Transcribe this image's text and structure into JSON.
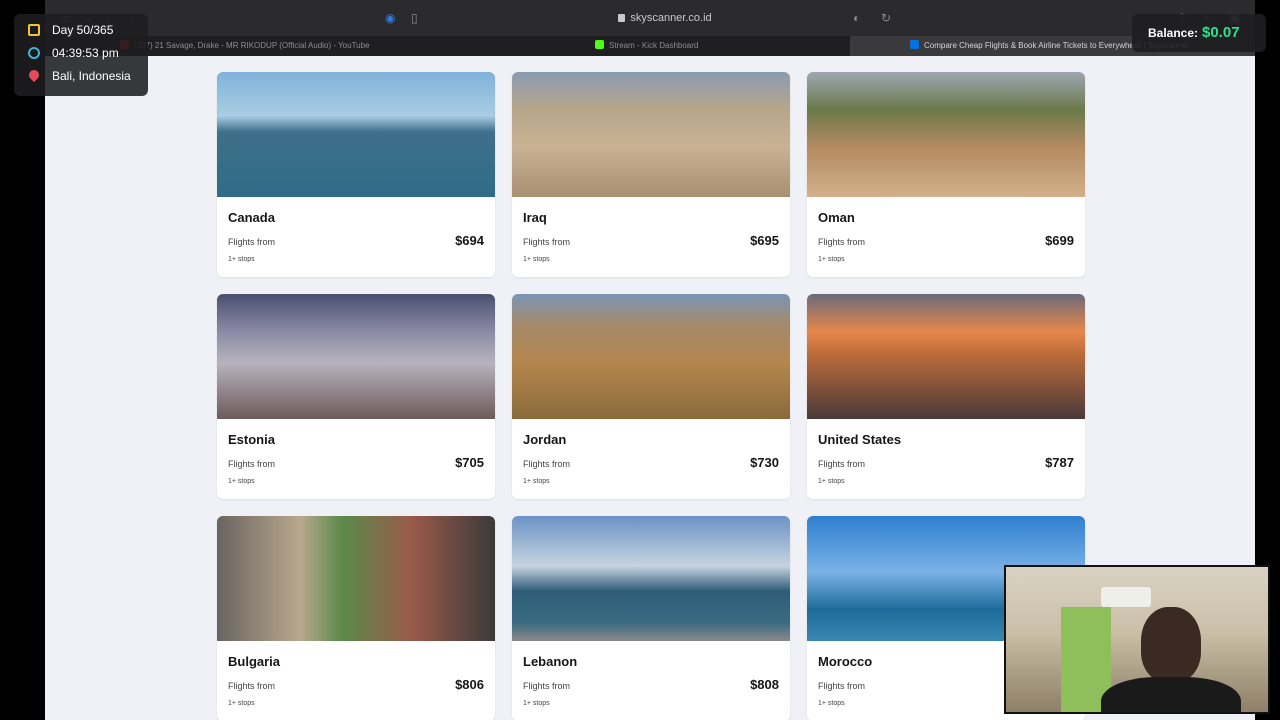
{
  "browser": {
    "url": "skyscanner.co.id",
    "tabs": [
      {
        "label": "(387) 21 Savage, Drake - MR RIKODUP (Official Audio) - YouTube",
        "fav_color": "#e62117"
      },
      {
        "label": "Stream - Kick Dashboard",
        "fav_color": "#53fc18"
      },
      {
        "label": "Compare Cheap Flights & Book Airline Tickets to Everywhere | Skyscanner",
        "fav_color": "#0770e3"
      }
    ]
  },
  "destinations": [
    {
      "name": "Canada",
      "from_label": "Flights from",
      "price": "$694",
      "stops": "1+ stops",
      "image": "city-skyline-waterfront"
    },
    {
      "name": "Iraq",
      "from_label": "Flights from",
      "price": "$695",
      "stops": "1+ stops",
      "image": "ancient-ruins"
    },
    {
      "name": "Oman",
      "from_label": "Flights from",
      "price": "$699",
      "stops": "1+ stops",
      "image": "desert-fort"
    },
    {
      "name": "Estonia",
      "from_label": "Flights from",
      "price": "$705",
      "stops": "1+ stops",
      "image": "snowy-old-town"
    },
    {
      "name": "Jordan",
      "from_label": "Flights from",
      "price": "$730",
      "stops": "1+ stops",
      "image": "hillside-city"
    },
    {
      "name": "United States",
      "from_label": "Flights from",
      "price": "$787",
      "stops": "1+ stops",
      "image": "sunset-skyline"
    },
    {
      "name": "Bulgaria",
      "from_label": "Flights from",
      "price": "$806",
      "stops": "1+ stops",
      "image": "monastery"
    },
    {
      "name": "Lebanon",
      "from_label": "Flights from",
      "price": "$808",
      "stops": "1+ stops",
      "image": "seaside-promenade"
    },
    {
      "name": "Morocco",
      "from_label": "Flights from",
      "price": "",
      "stops": "1+ stops",
      "image": "coastline"
    }
  ],
  "overlay": {
    "day": "Day 50/365",
    "time": "04:39:53 pm",
    "location": "Bali, Indonesia",
    "balance_label": "Balance:",
    "balance_value": "$0.07",
    "icons": [
      "calendar-icon",
      "clock-icon",
      "location-pin-icon"
    ],
    "colors": {
      "balance": "#2fe08a",
      "calendar": "#f3c33b",
      "clock": "#3fb3d8",
      "pin": "#e34b5a"
    }
  }
}
